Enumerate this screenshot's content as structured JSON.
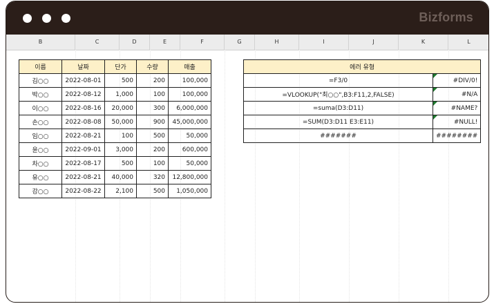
{
  "window": {
    "brand": "Bizforms"
  },
  "columns": [
    "B",
    "C",
    "D",
    "E",
    "F",
    "G",
    "H",
    "I",
    "J",
    "K",
    "L"
  ],
  "sales_table": {
    "headers": [
      "이름",
      "날짜",
      "단가",
      "수량",
      "매출"
    ],
    "rows": [
      [
        "김○○",
        "2022-08-01",
        "500",
        "200",
        "100,000"
      ],
      [
        "박○○",
        "2022-08-12",
        "1,000",
        "100",
        "100,000"
      ],
      [
        "이○○",
        "2022-08-16",
        "20,000",
        "300",
        "6,000,000"
      ],
      [
        "손○○",
        "2022-08-08",
        "50,000",
        "900",
        "45,000,000"
      ],
      [
        "임○○",
        "2022-08-21",
        "100",
        "500",
        "50,000"
      ],
      [
        "윤○○",
        "2022-09-01",
        "3,000",
        "200",
        "600,000"
      ],
      [
        "차○○",
        "2022-08-17",
        "500",
        "100",
        "50,000"
      ],
      [
        "유○○",
        "2022-08-21",
        "40,000",
        "320",
        "12,800,000"
      ],
      [
        "강○○",
        "2022-08-22",
        "2,100",
        "500",
        "1,050,000"
      ]
    ]
  },
  "error_table": {
    "header": "에러 유형",
    "rows": [
      [
        "=F3/0",
        "#DIV/0!"
      ],
      [
        "=VLOOKUP(\"최○○\",B3:F11,2,FALSE)",
        "#N/A"
      ],
      [
        "=suma(D3:D11)",
        "#NAME?"
      ],
      [
        "=SUM(D3:D11 E3:E11)",
        "#NULL!"
      ],
      [
        "#######",
        "########"
      ]
    ]
  },
  "colors": {
    "titlebar": "#2b1e19",
    "header_fill": "#fdf0c8",
    "error_marker": "#1f7a2e"
  }
}
